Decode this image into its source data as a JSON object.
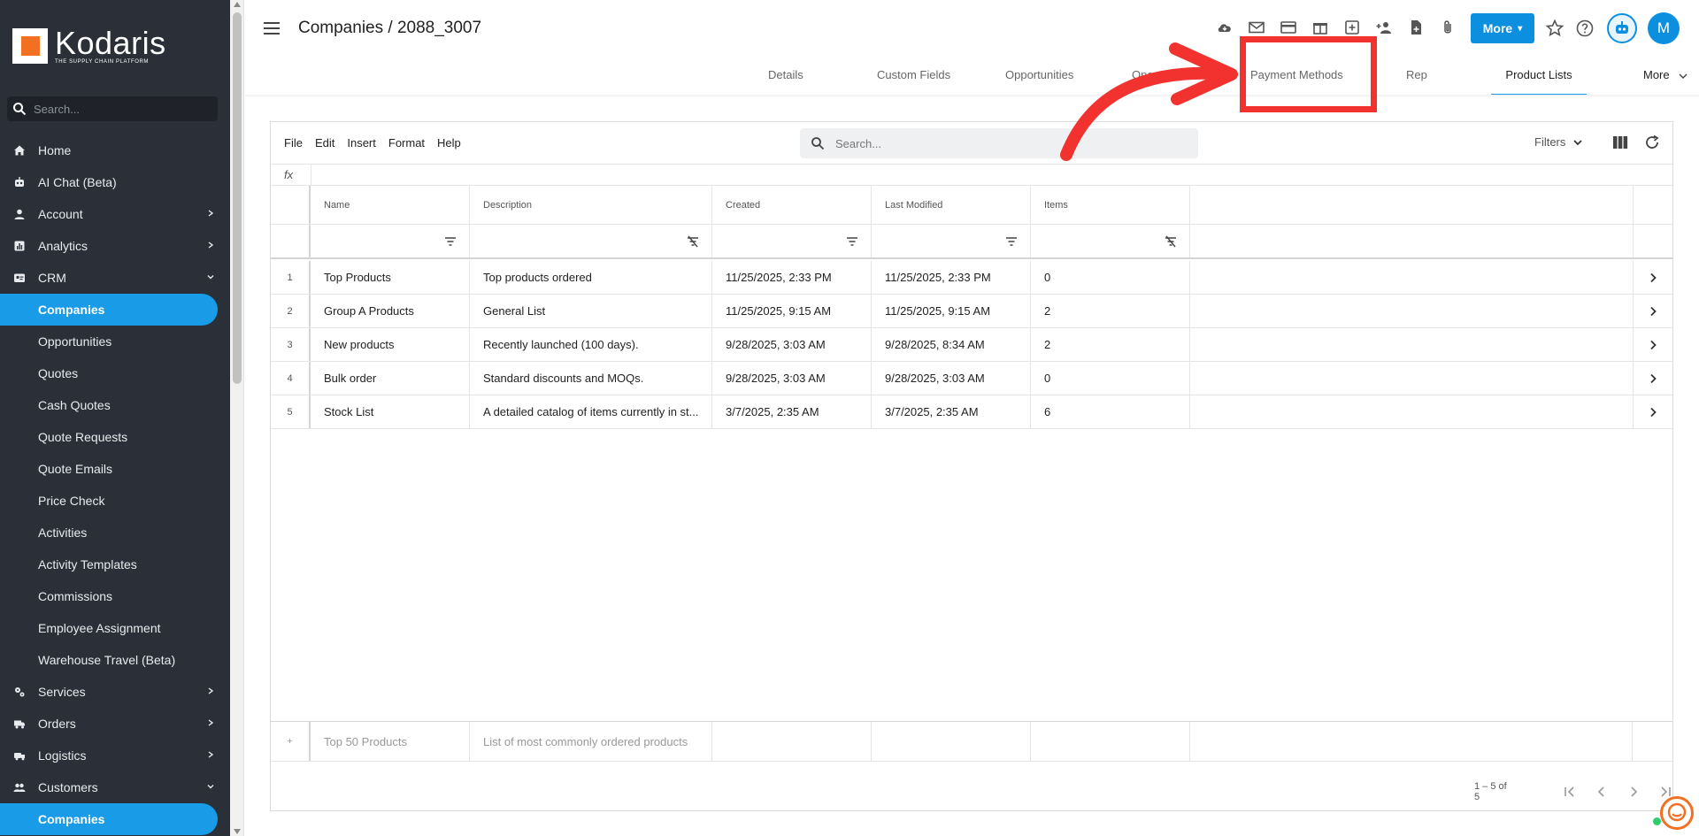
{
  "sidebar": {
    "brand": "Kodaris",
    "tagline": "THE SUPPLY CHAIN PLATFORM",
    "search_placeholder": "Search...",
    "items": [
      {
        "label": "Home",
        "icon": "home-icon"
      },
      {
        "label": "AI Chat (Beta)",
        "icon": "robot-icon"
      },
      {
        "label": "Account",
        "icon": "user-icon"
      },
      {
        "label": "Analytics",
        "icon": "chart-icon"
      },
      {
        "label": "CRM",
        "icon": "contact-card-icon"
      },
      {
        "label": "Companies"
      },
      {
        "label": "Opportunities"
      },
      {
        "label": "Quotes"
      },
      {
        "label": "Cash Quotes"
      },
      {
        "label": "Quote Requests"
      },
      {
        "label": "Quote Emails"
      },
      {
        "label": "Price Check"
      },
      {
        "label": "Activities"
      },
      {
        "label": "Activity Templates"
      },
      {
        "label": "Commissions"
      },
      {
        "label": "Employee Assignment"
      },
      {
        "label": "Warehouse Travel (Beta)"
      },
      {
        "label": "Services",
        "icon": "gears-icon"
      },
      {
        "label": "Orders",
        "icon": "truck-icon"
      },
      {
        "label": "Logistics",
        "icon": "delivery-icon"
      },
      {
        "label": "Customers",
        "icon": "users-icon"
      },
      {
        "label": "Companies"
      }
    ]
  },
  "header": {
    "title": "Companies / 2088_3007",
    "more_label": "More",
    "avatar_initial": "M"
  },
  "tabs": [
    {
      "label": "Details"
    },
    {
      "label": "Custom Fields"
    },
    {
      "label": "Opportunities"
    },
    {
      "label": "Open Invoices"
    },
    {
      "label": "Payment Methods"
    },
    {
      "label": "Rep"
    },
    {
      "label": "Product Lists"
    },
    {
      "label": "More"
    }
  ],
  "toolbar": {
    "menus": [
      "File",
      "Edit",
      "Insert",
      "Format",
      "Help"
    ],
    "search_placeholder": "Search...",
    "filters_label": "Filters"
  },
  "grid": {
    "fx_label": "fx",
    "columns": [
      "Name",
      "Description",
      "Created",
      "Last Modified",
      "Items"
    ],
    "rows": [
      {
        "idx": "1",
        "name": "Top Products",
        "description": "Top products ordered",
        "created": "11/25/2025, 2:33 PM",
        "modified": "11/25/2025, 2:33 PM",
        "items": "0"
      },
      {
        "idx": "2",
        "name": "Group A Products",
        "description": "General List",
        "created": "11/25/2025, 9:15 AM",
        "modified": "11/25/2025, 9:15 AM",
        "items": "2"
      },
      {
        "idx": "3",
        "name": "New products",
        "description": "Recently launched (100 days).",
        "created": "9/28/2025, 3:03 AM",
        "modified": "9/28/2025, 8:34 AM",
        "items": "2"
      },
      {
        "idx": "4",
        "name": "Bulk order",
        "description": "Standard discounts and MOQs.",
        "created": "9/28/2025, 3:03 AM",
        "modified": "9/28/2025, 3:03 AM",
        "items": "0"
      },
      {
        "idx": "5",
        "name": "Stock List",
        "description": "A detailed catalog of items currently in st...",
        "created": "3/7/2025, 2:35 AM",
        "modified": "3/7/2025, 2:35 AM",
        "items": "6"
      }
    ],
    "new_row": {
      "plus": "+",
      "name_placeholder": "Top 50 Products",
      "description_placeholder": "List of most commonly ordered products"
    },
    "pagination": "1 – 5 of 5"
  },
  "colors": {
    "sidebar_bg": "#2b3038",
    "accent": "#1a9be8",
    "highlight": "#f2322f",
    "brand_orange": "#f36f21"
  }
}
